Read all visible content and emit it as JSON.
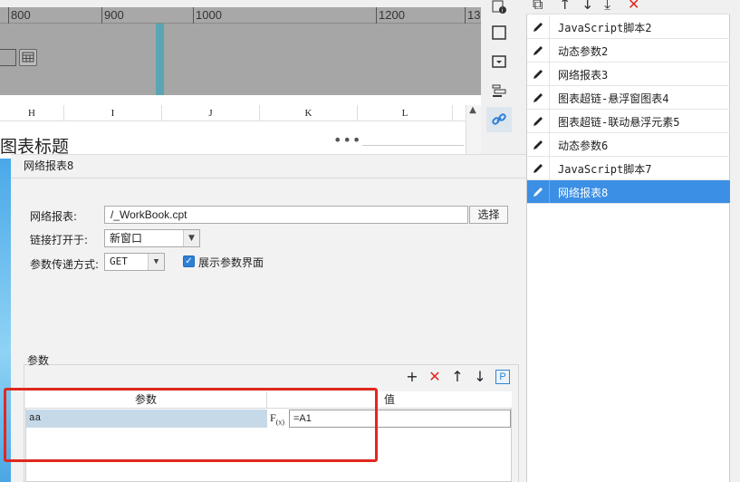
{
  "ruler": {
    "ticks": [
      "800",
      "900",
      "1000",
      "1200",
      "13"
    ]
  },
  "sheet": {
    "columns": [
      "H",
      "I",
      "J",
      "K",
      "L"
    ],
    "chart_title": "图表标题",
    "more_icon": "more-horizontal-icon",
    "scroll_up_glyph": "▲"
  },
  "toolbar_icons": [
    "info-icon",
    "rectangle-icon",
    "dropdown-box-icon",
    "layer-stack-icon",
    "link-icon"
  ],
  "list_toolbar": {
    "icons": [
      "copy-icon",
      "arrow-up-icon",
      "arrow-down-icon",
      "sort-down-icon",
      "delete-icon"
    ],
    "glyphs": [
      "⧉",
      "↑",
      "↓",
      "⤓",
      "✕"
    ],
    "delete_color": "#e0281e"
  },
  "hyperlink_list": {
    "items": [
      {
        "label": "JavaScript脚本2",
        "selected": false
      },
      {
        "label": "动态参数2",
        "selected": false
      },
      {
        "label": "网络报表3",
        "selected": false
      },
      {
        "label": "图表超链-悬浮窗图表4",
        "selected": false
      },
      {
        "label": "图表超链-联动悬浮元素5",
        "selected": false
      },
      {
        "label": "动态参数6",
        "selected": false
      },
      {
        "label": "JavaScript脚本7",
        "selected": false
      },
      {
        "label": "网络报表8",
        "selected": true
      }
    ],
    "selected_color": "#3b8fe4"
  },
  "dialog": {
    "title": "网络报表8",
    "report_label": "网络报表:",
    "report_value": "/_WorkBook.cpt",
    "select_button": "选择",
    "open_in_label": "链接打开于:",
    "open_in_value": "新窗口",
    "param_method_label": "参数传递方式:",
    "param_method_value": "GET",
    "show_params_checked": true,
    "show_params_label": "展示参数界面"
  },
  "params": {
    "section_label": "参数",
    "toolbar": {
      "add": "+",
      "delete": "✕",
      "up": "↑",
      "down": "↓",
      "p": "P"
    },
    "headers": [
      "参数",
      "值"
    ],
    "rows": [
      {
        "name": "aa",
        "fx": "F(x)",
        "value": "=A1"
      }
    ],
    "highlight_color": "#e0281e"
  }
}
